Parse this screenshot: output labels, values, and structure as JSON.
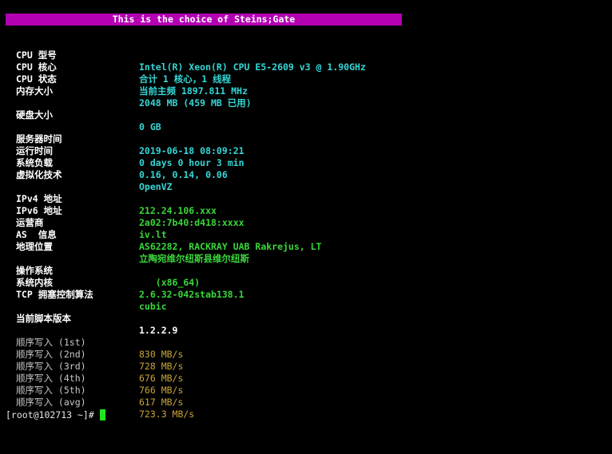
{
  "banner": "This is the choice of Steins;Gate",
  "system": {
    "cpu_model": {
      "label": "CPU 型号",
      "value": "Intel(R) Xeon(R) CPU E5-2609 v3 @ 1.90GHz"
    },
    "cpu_cores": {
      "label": "CPU 核心",
      "value": "合计 1 核心，1 线程"
    },
    "cpu_status": {
      "label": "CPU 状态",
      "value": "当前主频 1897.811 MHz"
    },
    "memory": {
      "label": "内存大小",
      "value": "2048 MB (459 MB 已用)"
    },
    "disk": {
      "label": "硬盘大小",
      "value": "0 GB"
    },
    "server_time": {
      "label": "服务器时间",
      "value": "2019-06-18 08:09:21"
    },
    "uptime": {
      "label": "运行时间",
      "value": "0 days 0 hour 3 min"
    },
    "load": {
      "label": "系统负载",
      "value": "0.16, 0.14, 0.06"
    },
    "virt": {
      "label": "虚拟化技术",
      "value": "OpenVZ"
    }
  },
  "network": {
    "ipv4": {
      "label": "IPv4 地址",
      "value": "212.24.106.xxx"
    },
    "ipv6": {
      "label": "IPv6 地址",
      "value": "2a02:7b40:d418:xxxx"
    },
    "isp": {
      "label": "运营商",
      "value": "iv.lt"
    },
    "as": {
      "label": "AS  信息",
      "value": "AS62282, RACKRAY UAB Rakrejus, LT"
    },
    "location": {
      "label": "地理位置",
      "value": "立陶宛维尔纽斯县维尔纽斯"
    }
  },
  "os": {
    "os": {
      "label": "操作系统",
      "value": "   (x86_64)"
    },
    "kernel": {
      "label": "系统内核",
      "value": "2.6.32-042stab138.1"
    },
    "tcp": {
      "label": "TCP 拥塞控制算法",
      "value": "cubic"
    }
  },
  "script": {
    "version": {
      "label": "当前脚本版本",
      "value": "1.2.2.9"
    }
  },
  "io": [
    {
      "label": "顺序写入 (1st)",
      "value": "830 MB/s"
    },
    {
      "label": "顺序写入 (2nd)",
      "value": "728 MB/s"
    },
    {
      "label": "顺序写入 (3rd)",
      "value": "676 MB/s"
    },
    {
      "label": "顺序写入 (4th)",
      "value": "766 MB/s"
    },
    {
      "label": "顺序写入 (5th)",
      "value": "617 MB/s"
    },
    {
      "label": "顺序写入 (avg)",
      "value": "723.3 MB/s"
    }
  ],
  "prompt": "[root@102713 ~]# ",
  "colors": {
    "banner_bg": "#b300b3",
    "value_cyan": "#35d6d6",
    "value_green": "#3ad63a",
    "io_label": "#c8c8c8",
    "io_value": "#c8a33a",
    "cursor": "#1ee61e"
  }
}
